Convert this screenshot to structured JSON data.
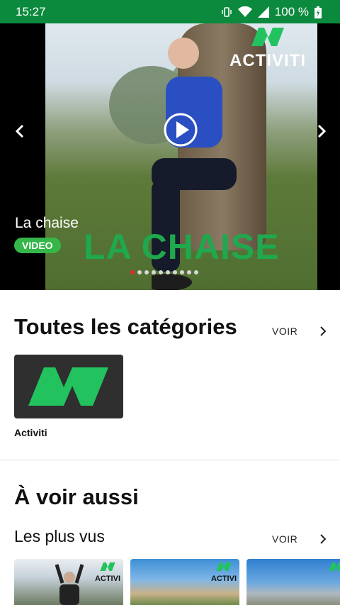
{
  "statusbar": {
    "time": "15:27",
    "battery": "100 %",
    "icons": [
      "vibrate-icon",
      "wifi-icon",
      "signal-icon",
      "battery-icon"
    ]
  },
  "hero": {
    "brand": "ACTIVITI",
    "overlay_title": "LA CHAISE",
    "title": "La chaise",
    "badge": "VIDEO",
    "dots_total": 10,
    "active_dot": 1
  },
  "categories": {
    "heading": "Toutes les catégories",
    "voir": "VOIR",
    "items": [
      {
        "label": "Activiti"
      }
    ]
  },
  "see_also": {
    "heading": "À voir aussi",
    "subheading": "Les plus vus",
    "voir": "VOIR",
    "thumb_brand": "ACTIVI"
  },
  "colors": {
    "statusbar": "#0b8a3e",
    "accent_green": "#35b649",
    "logo_green": "#22c35e",
    "dot_active": "#e22c2c"
  }
}
